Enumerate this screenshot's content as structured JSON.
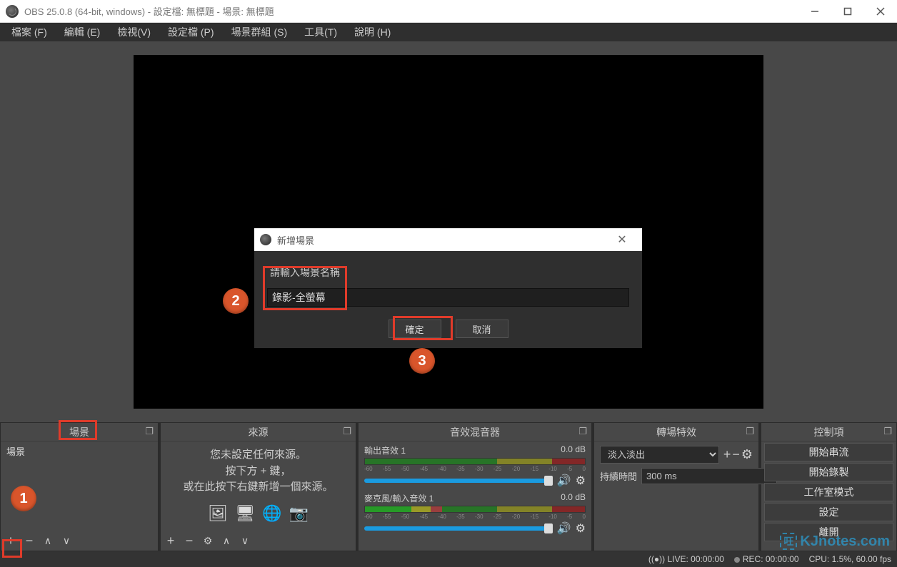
{
  "title": "OBS 25.0.8 (64-bit, windows) - 設定檔: 無標題 - 場景: 無標題",
  "menu": {
    "file": "檔案 (F)",
    "edit": "編輯 (E)",
    "view": "檢視(V)",
    "profile": "設定檔 (P)",
    "sceneCollection": "場景群組 (S)",
    "tools": "工具(T)",
    "help": "說明 (H)"
  },
  "dialog": {
    "title": "新增場景",
    "prompt": "請輸入場景名稱",
    "value": "錄影-全螢幕",
    "ok": "確定",
    "cancel": "取消"
  },
  "panels": {
    "scenes": {
      "title": "場景",
      "items": [
        "場景"
      ]
    },
    "sources": {
      "title": "來源",
      "empty1": "您未設定任何來源。",
      "empty2": "按下方 + 鍵，",
      "empty3": "或在此按下右鍵新增一個來源。"
    },
    "mixer": {
      "title": "音效混音器",
      "ticks": [
        "-60",
        "-55",
        "-50",
        "-45",
        "-40",
        "-35",
        "-30",
        "-25",
        "-20",
        "-15",
        "-10",
        "-5",
        "0"
      ],
      "channels": [
        {
          "name": "輸出音效 1",
          "db": "0.0 dB",
          "level": "0%"
        },
        {
          "name": "麥克風/輸入音效 1",
          "db": "0.0 dB",
          "level": "35%"
        }
      ]
    },
    "transitions": {
      "title": "轉場特效",
      "selected": "淡入淡出",
      "durationLabel": "持續時間",
      "duration": "300 ms"
    },
    "controls": {
      "title": "控制項",
      "buttons": {
        "stream": "開始串流",
        "record": "開始錄製",
        "studio": "工作室模式",
        "settings": "設定",
        "exit": "離開"
      }
    }
  },
  "status": {
    "live": "LIVE: 00:00:00",
    "rec": "REC: 00:00:00",
    "cpu": "CPU: 1.5%, 60.00 fps"
  },
  "annotations": {
    "b1": "1",
    "b2": "2",
    "b3": "3"
  },
  "watermark": "KJnotes.com"
}
